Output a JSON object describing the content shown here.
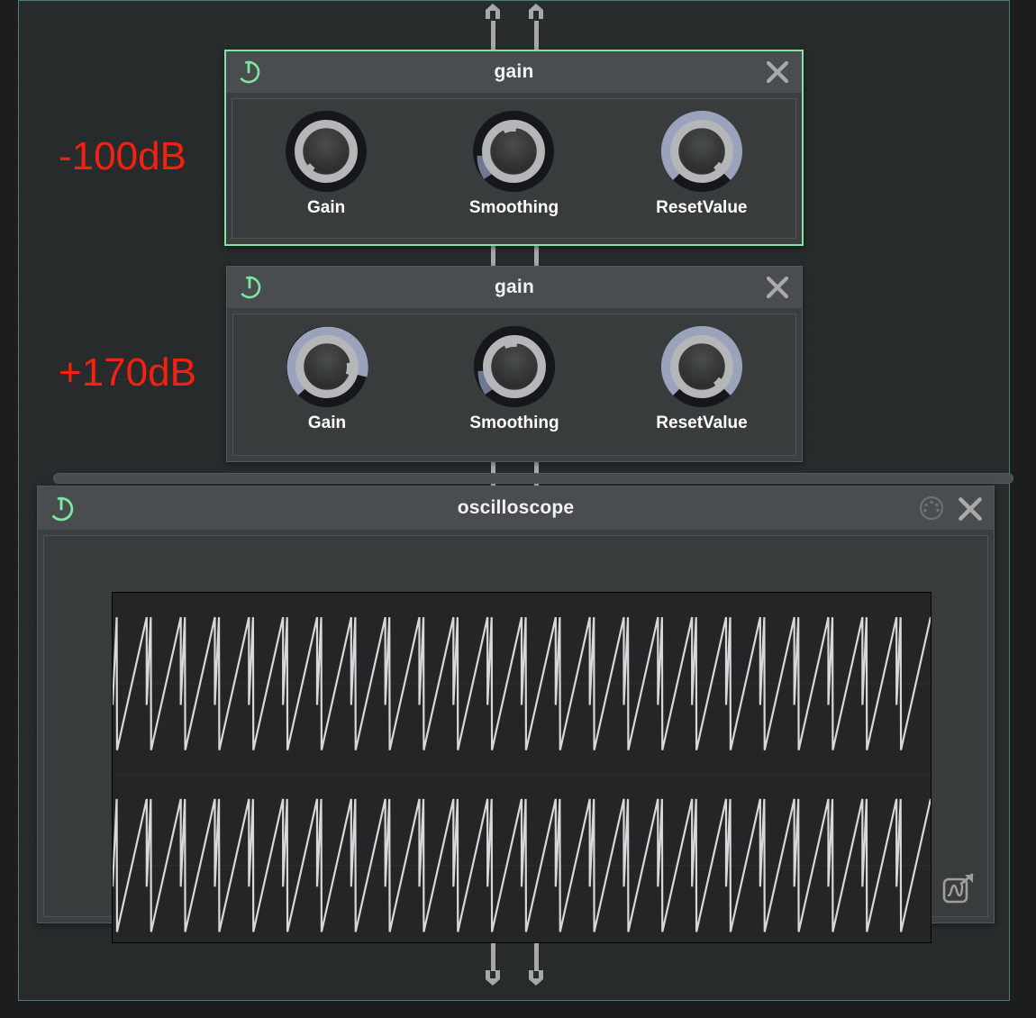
{
  "canvas": {
    "background_color": "#272b2b",
    "border_color": "#4d7b78"
  },
  "annotations": [
    {
      "text": "-100dB",
      "color": "#f42110"
    },
    {
      "text": "+170dB",
      "color": "#f42110"
    }
  ],
  "modules": [
    {
      "id": "gain-1",
      "title": "gain",
      "selected": true,
      "selection_color": "#7fe6a0",
      "power_on": true,
      "power_color": "#7fe6a0",
      "close_label": "close",
      "knobs": [
        {
          "name": "Gain",
          "value_angle": -140,
          "arc_color": "#9aa3bb",
          "track_color": "#15171a"
        },
        {
          "name": "Smoothing",
          "value_angle": -10,
          "arc_color": "#9aa3bb",
          "track_color": "#15171a"
        },
        {
          "name": "ResetValue",
          "value_angle": 140,
          "arc_color": "#9aa3bb",
          "track_color": "#15171a"
        }
      ]
    },
    {
      "id": "gain-2",
      "title": "gain",
      "selected": false,
      "selection_color": "#7fe6a0",
      "power_on": true,
      "power_color": "#7fe6a0",
      "close_label": "close",
      "knobs": [
        {
          "name": "Gain",
          "value_angle": 96,
          "arc_color": "#9aa3bb",
          "track_color": "#15171a"
        },
        {
          "name": "Smoothing",
          "value_angle": -10,
          "arc_color": "#9aa3bb",
          "track_color": "#15171a"
        },
        {
          "name": "ResetValue",
          "value_angle": 140,
          "arc_color": "#9aa3bb",
          "track_color": "#15171a"
        }
      ]
    },
    {
      "id": "oscilloscope-1",
      "title": "oscilloscope",
      "selected": false,
      "power_on": true,
      "power_color": "#7fe6a0",
      "close_label": "close",
      "midi_label": "midi-learn",
      "popout_label": "open-graph"
    }
  ],
  "chart_data": {
    "type": "line",
    "title": "oscilloscope",
    "xlabel": "",
    "ylabel": "",
    "grid": true,
    "legend": "none",
    "traces": [
      {
        "name": "channel-1",
        "waveform": "sawtooth",
        "cycles": 24,
        "amplitude": 0.38,
        "baseline_y": 0.26,
        "color": "#d8d8d8"
      },
      {
        "name": "channel-2",
        "waveform": "sawtooth",
        "cycles": 24,
        "amplitude": 0.38,
        "baseline_y": 0.78,
        "color": "#d8d8d8"
      }
    ],
    "xlim": [
      0,
      1
    ],
    "ylim": [
      -1,
      1
    ]
  },
  "ports": {
    "top": [
      {
        "name": "input-left",
        "direction": "up"
      },
      {
        "name": "input-right",
        "direction": "up"
      }
    ],
    "bottom": [
      {
        "name": "output-left",
        "direction": "down"
      },
      {
        "name": "output-right",
        "direction": "down"
      }
    ]
  }
}
